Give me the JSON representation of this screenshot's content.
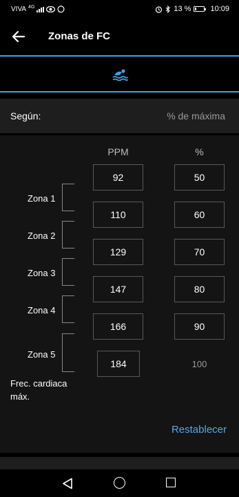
{
  "status_bar": {
    "carrier": "VIVA",
    "network": "4G",
    "battery_percent": "13 %",
    "battery_level": 0.13,
    "time": "10:09",
    "icons": [
      "eye-icon",
      "whatsapp-icon",
      "alarm-icon",
      "bluetooth-icon",
      "battery-icon"
    ]
  },
  "header": {
    "title": "Zonas de FC",
    "back_icon": "arrow-left-icon"
  },
  "tab": {
    "icon": "swimming-icon",
    "accent_color": "#3ea3e6"
  },
  "segun": {
    "label": "Según:",
    "value": "% de máxima"
  },
  "table": {
    "col_ppm": "PPM",
    "col_pct": "%",
    "ppm": [
      "92",
      "110",
      "129",
      "147",
      "166",
      "184"
    ],
    "pct": [
      "50",
      "60",
      "70",
      "80",
      "90",
      "100"
    ],
    "zones": [
      "Zona 1",
      "Zona 2",
      "Zona 3",
      "Zona 4",
      "Zona 5"
    ],
    "max_hr_line1": "Frec. cardiaca",
    "max_hr_line2": "máx."
  },
  "actions": {
    "reset": "Restablecer",
    "reset_color": "#5aa8e8"
  },
  "nav": {
    "icons": [
      "nav-back-icon",
      "nav-home-icon",
      "nav-recents-icon"
    ]
  }
}
